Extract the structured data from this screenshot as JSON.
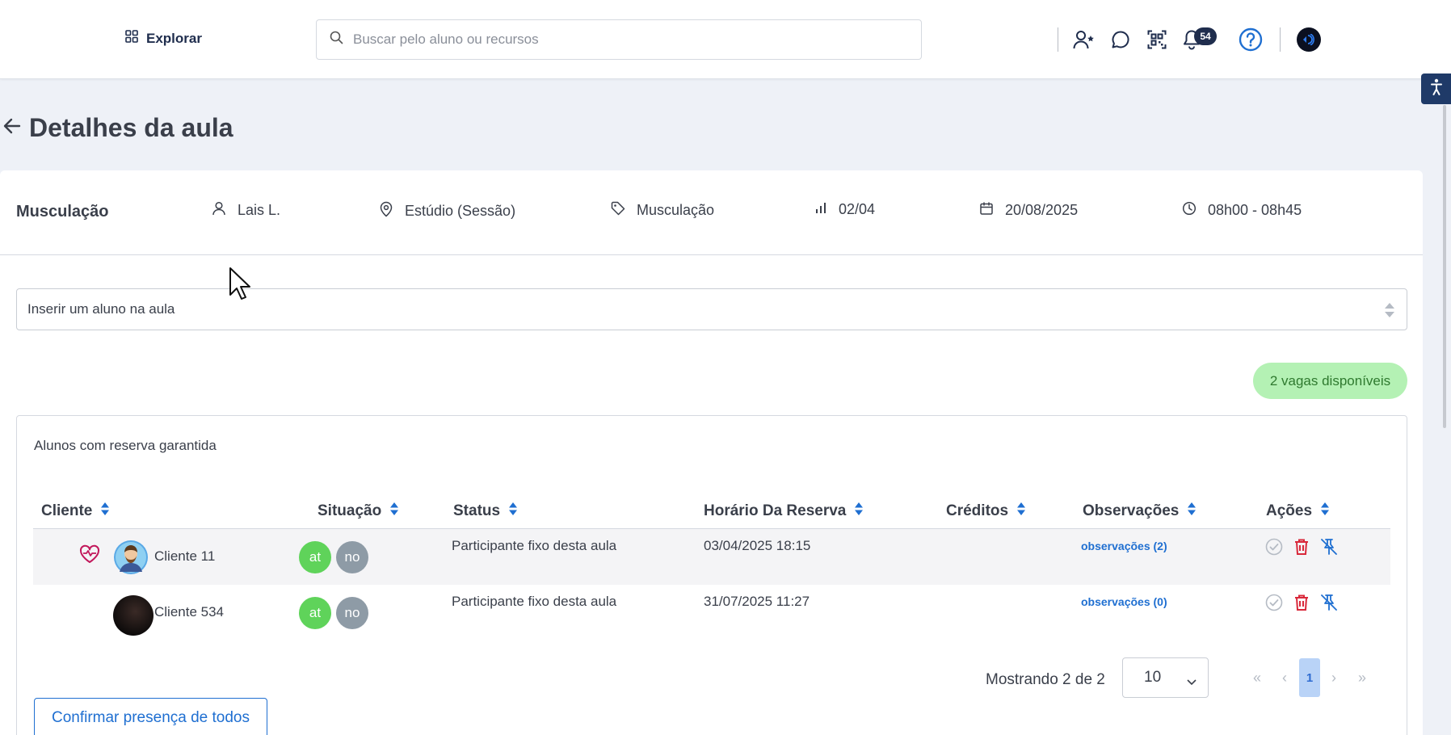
{
  "header": {
    "explore_label": "Explorar",
    "search_placeholder": "Buscar pelo aluno ou recursos",
    "notifications_count": "54",
    "icons": [
      "grid-icon",
      "search-icon",
      "add-user-icon",
      "chat-icon",
      "qr-code-icon",
      "bell-icon",
      "help-icon",
      "avatar"
    ]
  },
  "page": {
    "title": "Detalhes da aula"
  },
  "class_info": {
    "name": "Musculação",
    "instructor": "Lais L.",
    "location": "Estúdio (Sessão)",
    "modality": "Musculação",
    "occupancy": "02/04",
    "date": "20/08/2025",
    "time": "08h00 - 08h45"
  },
  "insert_student": {
    "placeholder": "Inserir um aluno na aula"
  },
  "vagas_label": "2 vagas disponíveis",
  "table": {
    "heading": "Alunos com reserva garantida",
    "columns": [
      "Cliente",
      "Situação",
      "Status",
      "Horário Da Reserva",
      "Créditos",
      "Observações",
      "Ações"
    ],
    "rows": [
      {
        "client": "Cliente 11",
        "situation": [
          "at",
          "no"
        ],
        "status": "Participante fixo desta aula",
        "reservation_time": "03/04/2025 18:15",
        "credits": "",
        "observations": "observações (2)"
      },
      {
        "client": "Cliente 534",
        "situation": [
          "at",
          "no"
        ],
        "status": "Participante fixo desta aula",
        "reservation_time": "31/07/2025 11:27",
        "credits": "",
        "observations": "observações (0)"
      }
    ]
  },
  "pagination": {
    "showing": "Mostrando 2 de 2",
    "per_page": "10",
    "current_page": "1",
    "first": "«",
    "prev": "‹",
    "next": "›",
    "last": "»"
  },
  "confirm_all_label": "Confirmar presença de todos",
  "colors": {
    "brand_dark": "#1f2d4d",
    "link_blue": "#1f6fd1",
    "present_green": "#5fd35a",
    "absent_gray": "#8e9ba6",
    "vagas_bg": "#b4f1b4",
    "delete_red": "#d9283a"
  }
}
